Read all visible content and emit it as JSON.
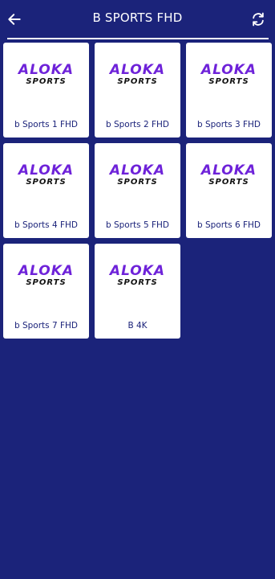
{
  "header": {
    "title": "B SPORTS FHD",
    "back_icon": "arrow-left-icon",
    "refresh_icon": "refresh-icon"
  },
  "logo": {
    "line1": "ALOKA",
    "line2": "SPORTS"
  },
  "channels": [
    {
      "label": "b Sports 1 FHD"
    },
    {
      "label": "b Sports 2 FHD"
    },
    {
      "label": "b Sports 3 FHD"
    },
    {
      "label": "b Sports 4 FHD"
    },
    {
      "label": "b Sports 5 FHD"
    },
    {
      "label": "b Sports 6 FHD"
    },
    {
      "label": "b Sports 7 FHD"
    },
    {
      "label": "B 4K"
    }
  ],
  "colors": {
    "background": "#1b237a",
    "card": "#ffffff",
    "logo_accent": "#6e22d9",
    "label_text": "#1b237a"
  }
}
